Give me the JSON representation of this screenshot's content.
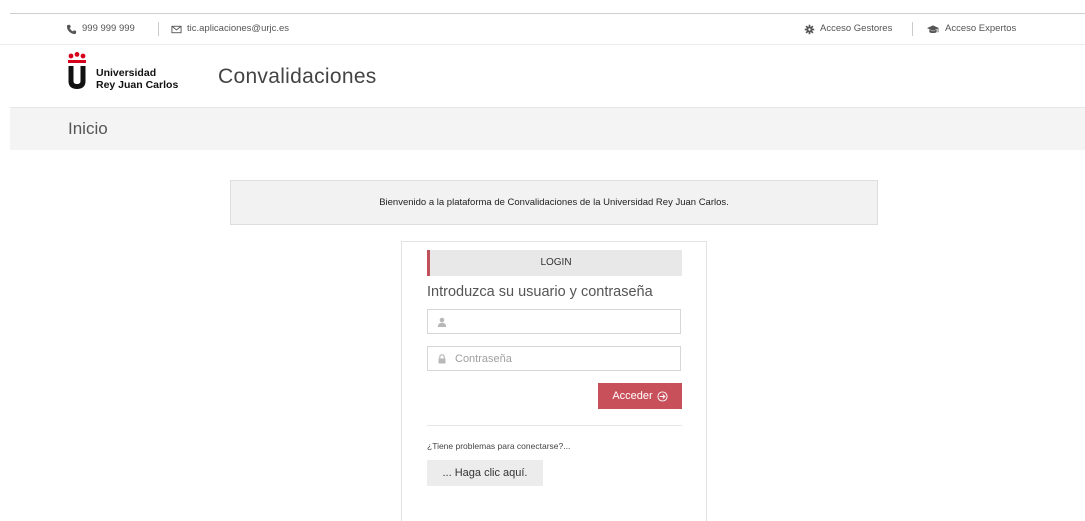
{
  "topbar": {
    "phone": "999 999 999",
    "email": "tic.aplicaciones@urjc.es",
    "gestores": "Acceso Gestores",
    "expertos": "Acceso Expertos"
  },
  "header": {
    "logo_line1": "Universidad",
    "logo_line2": "Rey Juan Carlos",
    "app_title": "Convalidaciones"
  },
  "breadcrumb": {
    "title": "Inicio"
  },
  "welcome": {
    "text": "Bienvenido a la plataforma de Convalidaciones de la Universidad Rey Juan Carlos."
  },
  "login": {
    "heading": "LOGIN",
    "subtitle": "Introduzca su usuario y contraseña",
    "username_value": "",
    "password_placeholder": "Contraseña",
    "submit_label": "Acceder",
    "problems_text": "¿Tiene problemas para conectarse?...",
    "help_label": "... Haga clic aquí."
  },
  "colors": {
    "accent": "#c8505b",
    "panel_bg": "#f2f2f2",
    "brand_red": "#d6001c"
  },
  "icons": {
    "phone": "phone-icon",
    "email": "envelope-icon",
    "gestores": "gear-icon",
    "expertos": "graduation-cap-icon",
    "user": "user-icon",
    "lock": "lock-icon",
    "submit": "arrow-circle-right-icon"
  }
}
